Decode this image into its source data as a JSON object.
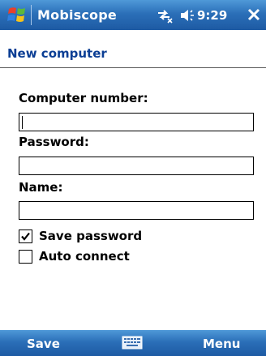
{
  "status_bar": {
    "app_title": "Mobiscope",
    "time": "9:29",
    "icons": [
      "windows-start-icon",
      "connectivity-icon",
      "volume-icon",
      "close-icon"
    ]
  },
  "page": {
    "title": "New computer"
  },
  "form": {
    "computer_number": {
      "label": "Computer number:",
      "value": ""
    },
    "password": {
      "label": "Password:",
      "value": ""
    },
    "name": {
      "label": "Name:",
      "value": ""
    },
    "save_password": {
      "label": "Save password",
      "checked": true
    },
    "auto_connect": {
      "label": "Auto connect",
      "checked": false
    }
  },
  "softkeys": {
    "left": "Save",
    "right": "Menu",
    "center_icon": "keyboard-icon"
  },
  "colors": {
    "bar_top": "#4f99d8",
    "bar_bottom": "#1d5aa3",
    "page_title": "#0b3e94"
  }
}
